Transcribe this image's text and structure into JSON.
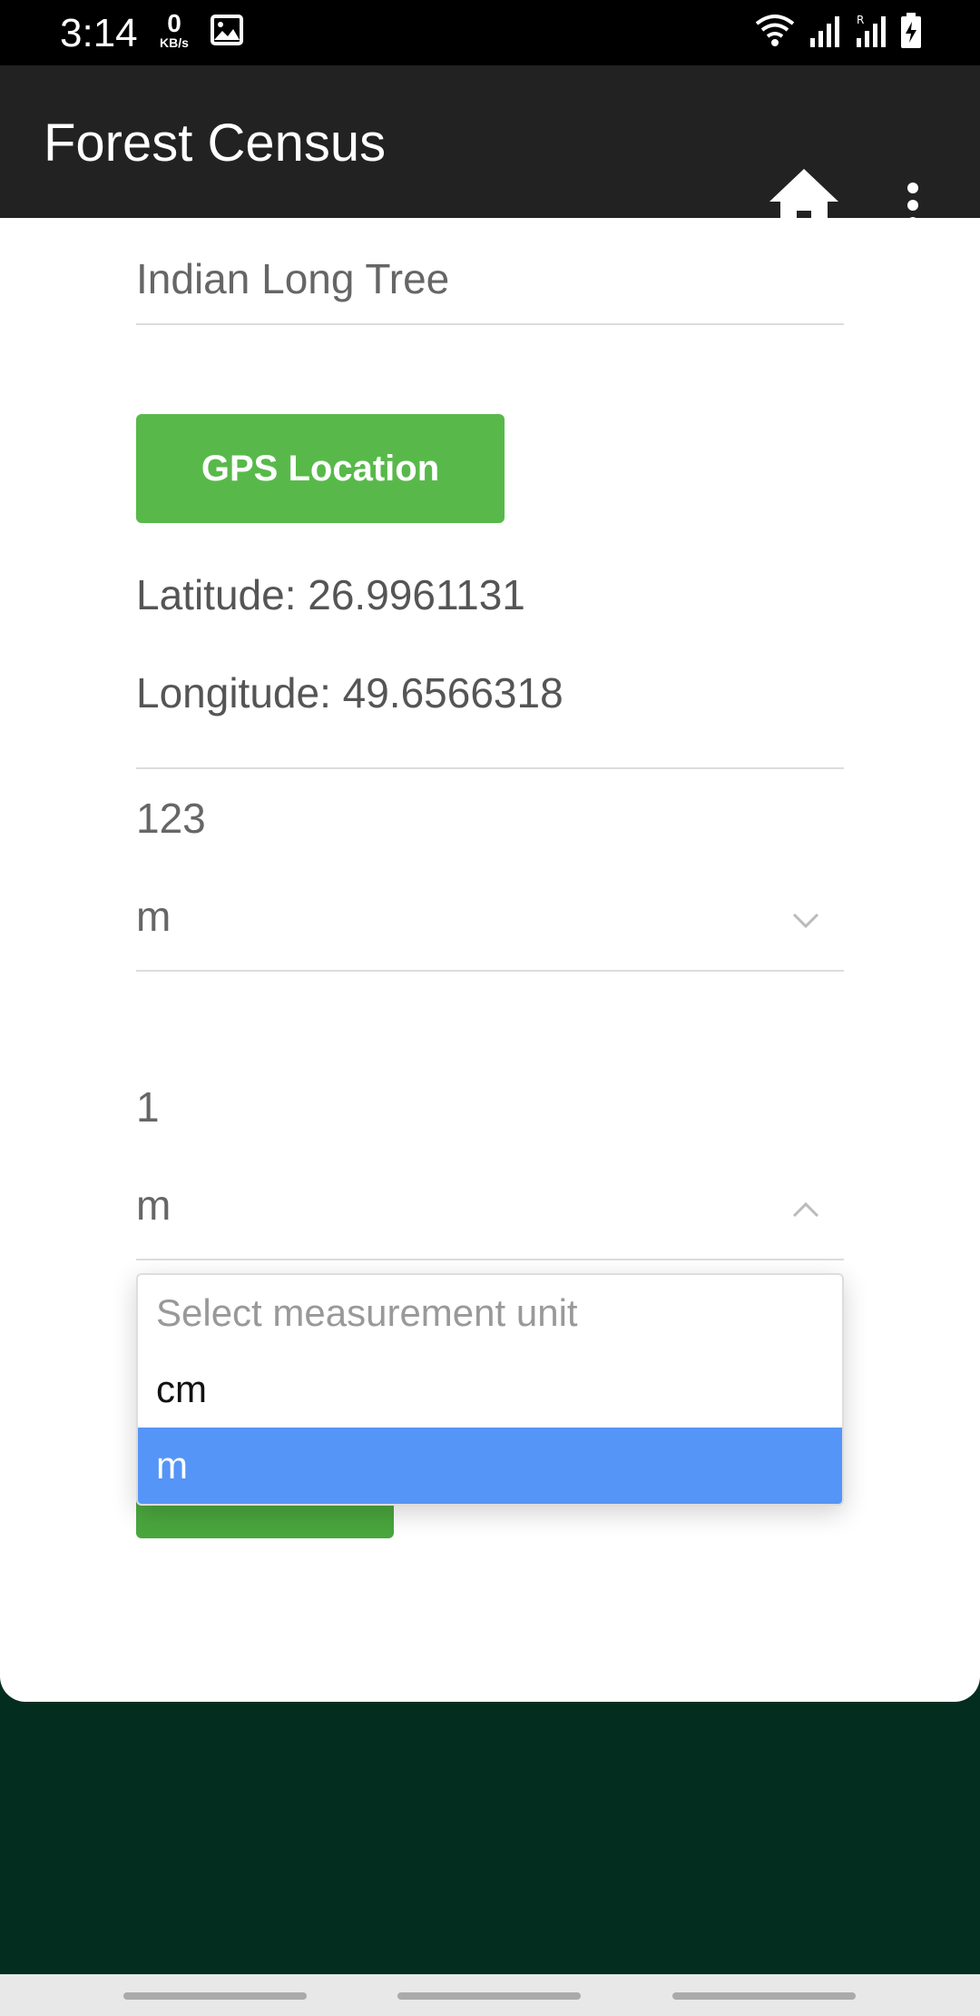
{
  "status_bar": {
    "time": "3:14",
    "net_speed_value": "0",
    "net_speed_unit": "KB/s"
  },
  "app_bar": {
    "title": "Forest Census"
  },
  "form": {
    "tree_name": "Indian Long Tree",
    "gps_button_label": "GPS Location",
    "latitude": "Latitude: 26.9961131",
    "longitude": "Longitude: 49.6566318",
    "height_value": "123",
    "height_unit": "m",
    "girth_value": "1",
    "girth_unit": "m"
  },
  "dropdown": {
    "placeholder": "Select measurement unit",
    "options": [
      "cm",
      "m"
    ],
    "selected": "m",
    "highlight_color": "#5595f7"
  },
  "colors": {
    "app_bar": "#222222",
    "gps_button": "#58b94a",
    "background": "#032e1f"
  }
}
